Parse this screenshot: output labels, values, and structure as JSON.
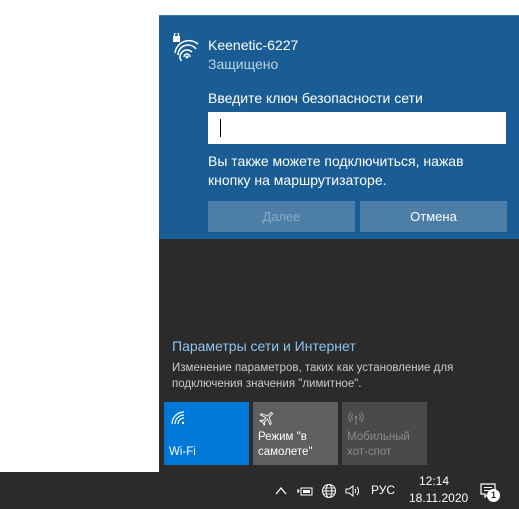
{
  "network": {
    "name": "Keenetic-6227",
    "status": "Защищено",
    "key_prompt": "Введите ключ безопасности сети",
    "key_value": "",
    "router_hint": "Вы также можете подключиться, нажав кнопку на маршрутизаторе.",
    "next_label": "Далее",
    "cancel_label": "Отмена"
  },
  "settings": {
    "link": "Параметры сети и Интернет",
    "description": "Изменение параметров, таких как установление для подключения значения \"лимитное\"."
  },
  "tiles": {
    "wifi": {
      "label": "Wi-Fi",
      "icon": "wifi-icon"
    },
    "airplane": {
      "label": "Режим \"в самолете\"",
      "icon": "airplane-icon"
    },
    "hotspot": {
      "label": "Мобильный хот-спот",
      "icon": "hotspot-icon"
    }
  },
  "taskbar": {
    "language": "РУС",
    "time": "12:14",
    "date": "18.11.2020",
    "notification_count": "1"
  },
  "colors": {
    "card": "#1a5d94",
    "accent": "#0078d7",
    "link": "#8cc4f0",
    "flyout": "#2b2b2b"
  }
}
